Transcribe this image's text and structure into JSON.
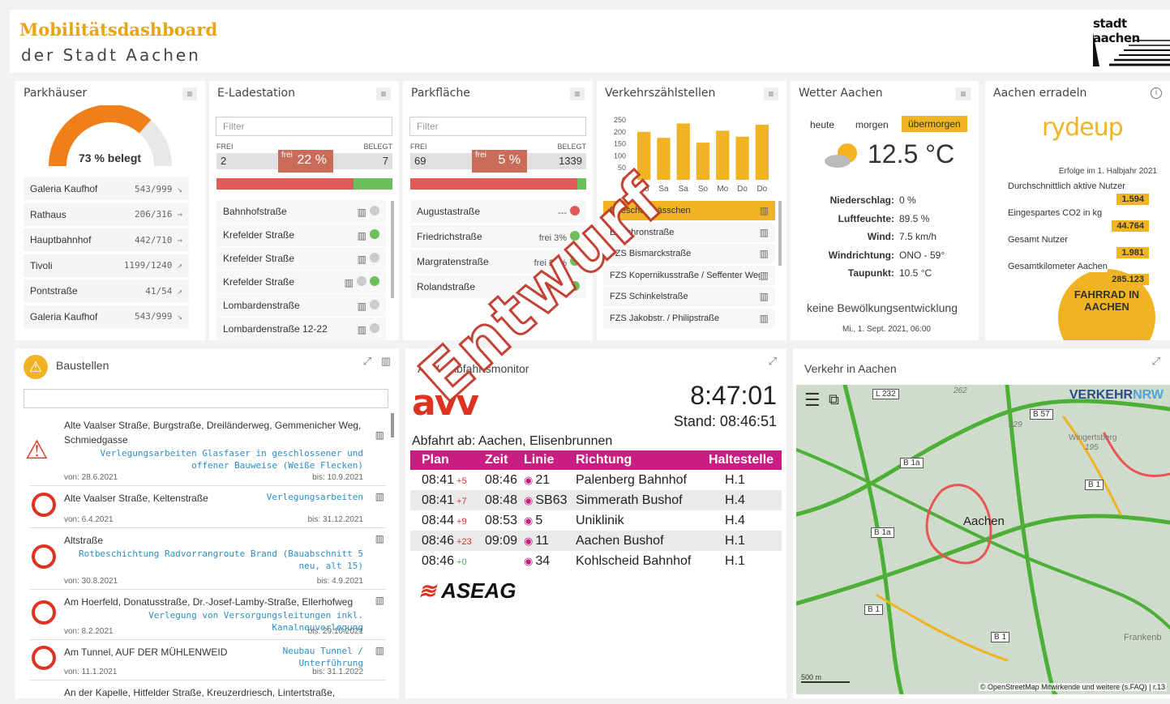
{
  "header": {
    "title": "Mobilitätsdashboard",
    "subtitle": "der Stadt Aachen",
    "logo_text": "stadt aachen"
  },
  "parkhaeuser": {
    "title": "Parkhäuser",
    "gauge_label": "73 % belegt",
    "occupancy_percent": 73,
    "items": [
      {
        "name": "Galeria Kaufhof",
        "value": "543/999",
        "trend": "↘"
      },
      {
        "name": "Rathaus",
        "value": "206/316",
        "trend": "→"
      },
      {
        "name": "Hauptbahnhof",
        "value": "442/710",
        "trend": "→"
      },
      {
        "name": "Tivoli",
        "value": "1199/1240",
        "trend": "↗"
      },
      {
        "name": "Pontstraße",
        "value": "41/54",
        "trend": "↗"
      },
      {
        "name": "Galeria Kaufhof",
        "value": "543/999",
        "trend": "↘"
      }
    ]
  },
  "eladestation": {
    "title": "E-Ladestation",
    "filter_placeholder": "Filter",
    "frei_label": "FREI",
    "belegt_label": "BELEGT",
    "frei": "2",
    "frei_small": "frei",
    "percent": "22 %",
    "belegt": "7",
    "free_fraction": 0.78,
    "items": [
      {
        "name": "Bahnhofstraße",
        "dots": [
          "#ccc"
        ]
      },
      {
        "name": "Krefelder Straße",
        "dots": [
          "#6cbf5a"
        ]
      },
      {
        "name": "Krefelder Straße",
        "dots": [
          "#ccc"
        ]
      },
      {
        "name": "Krefelder Straße",
        "dots": [
          "#ccc",
          "#6cbf5a"
        ]
      },
      {
        "name": "Lombardenstraße",
        "dots": [
          "#ccc"
        ]
      },
      {
        "name": "Lombardenstraße 12-22",
        "dots": [
          "#ccc"
        ]
      }
    ]
  },
  "parkflaeche": {
    "title": "Parkfläche",
    "filter_placeholder": "Filter",
    "frei_label": "FREI",
    "belegt_label": "BELEGT",
    "frei": "69",
    "frei_small": "frei",
    "percent": "5 %",
    "belegt": "1339",
    "free_fraction": 0.95,
    "items": [
      {
        "name": "Augustastraße",
        "value": "---",
        "color": "#e05a5a"
      },
      {
        "name": "Friedrichstraße",
        "value": "frei 3%",
        "color": "#6cbf5a"
      },
      {
        "name": "Margratenstraße",
        "value": "frei 22%",
        "color": "#6cbf5a"
      },
      {
        "name": "Rolandstraße",
        "value": "frei 7%",
        "color": "#6cbf5a"
      }
    ]
  },
  "verkehr_zaehl": {
    "title": "Verkehrszählstellen",
    "chart_data": {
      "type": "bar",
      "categories": [
        "Do",
        "Sa",
        "Sa",
        "So",
        "Mo",
        "Do",
        "Do"
      ],
      "values": [
        200,
        175,
        235,
        155,
        205,
        180,
        230
      ],
      "ylim": [
        0,
        250
      ],
      "yticks": [
        "250",
        "200",
        "150",
        "100",
        "50",
        "0"
      ]
    },
    "items": [
      {
        "name": "Driescher Gässchen"
      },
      {
        "name": "Eilfschronstraße"
      },
      {
        "name": "FZS Bismarckstraße"
      },
      {
        "name": "FZS Kopernikusstraße / Seffenter Weg"
      },
      {
        "name": "FZS Schinkelstraße"
      },
      {
        "name": "FZS Jakobstr. / Philipstraße"
      }
    ]
  },
  "wetter": {
    "title": "Wetter Aachen",
    "tabs": [
      "heute",
      "morgen",
      "übermorgen"
    ],
    "temp": "12.5",
    "unit": "°C",
    "rows": [
      {
        "k": "Niederschlag:",
        "v": "0 %"
      },
      {
        "k": "Luftfeuchte:",
        "v": "89.5 %"
      },
      {
        "k": "Wind:",
        "v": "7.5 km/h"
      },
      {
        "k": "Windrichtung:",
        "v": "ONO - 59°"
      },
      {
        "k": "Taupunkt:",
        "v": "10.5 °C"
      }
    ],
    "desc": "keine Bewölkungsentwicklung",
    "date": "Mi., 1. Sept. 2021, 06:00"
  },
  "erradeln": {
    "title": "Aachen erradeln",
    "logo": "rydeup",
    "subtitle": "Erfolge im 1. Halbjahr 2021",
    "stats": [
      {
        "k": "Durchschnittlich aktive Nutzer",
        "v": "1.594"
      },
      {
        "k": "Eingespartes CO2 in kg",
        "v": "44.764"
      },
      {
        "k": "Gesamt Nutzer",
        "v": "1.981"
      },
      {
        "k": "Gesamtkilometer Aachen",
        "v": "285.123"
      }
    ],
    "badge": "FAHRRAD IN AACHEN"
  },
  "baustellen": {
    "title": "Baustellen",
    "items": [
      {
        "title": "Alte Vaalser Straße, Burgstraße, Dreiländerweg, Gemmenicher Weg, Schmiedgasse",
        "link": "Verlegungsarbeiten Glasfaser in geschlossener und offener Bauweise (Weiße Flecken)",
        "von": "von: 28.6.2021",
        "bis": "bis: 10.9.2021"
      },
      {
        "title": "Alte Vaalser Straße, Keltenstraße",
        "link": "Verlegungsarbeiten",
        "von": "von: 6.4.2021",
        "bis": "bis: 31.12.2021"
      },
      {
        "title": "Altstraße",
        "link": "Rotbeschichtung Radvorrangroute Brand (Bauabschnitt 5 neu, alt 15)",
        "von": "von: 30.8.2021",
        "bis": "bis: 4.9.2021"
      },
      {
        "title": "Am Hoerfeld, Donatusstraße, Dr.-Josef-Lamby-Straße, Ellerhofweg",
        "link": "Verlegung von Versorgungsleitungen inkl. Kanalneuverlegung",
        "von": "von: 8.2.2021",
        "bis": "bis: 29.10.2021"
      },
      {
        "title": "Am Tunnel, AUF DER MÜHLENWEID",
        "link": "Neubau Tunnel / Unterführung",
        "von": "von: 11.1.2021",
        "bis": "bis: 31.1.2022"
      },
      {
        "title": "An der Kapelle, Hitfelder Straße, Kreuzerdriesch, Lintertstraße,",
        "link": "",
        "von": "",
        "bis": ""
      }
    ]
  },
  "avv": {
    "title": "AVV - Abfahrtsmonitor",
    "logo": "avv",
    "time": "8:47:01",
    "stand": "Stand: 08:46:51",
    "stop": "Abfahrt ab: Aachen, Elisenbrunnen",
    "headers": [
      "Plan",
      "Zeit",
      "Linie",
      "Richtung",
      "Haltestelle"
    ],
    "rows": [
      {
        "plan": "08:41",
        "delay": "+5",
        "zeit": "08:46",
        "linie": "21",
        "richtung": "Palenberg Bahnhof",
        "halt": "H.1"
      },
      {
        "plan": "08:41",
        "delay": "+7",
        "zeit": "08:48",
        "linie": "SB63",
        "richtung": "Simmerath Bushof",
        "halt": "H.4"
      },
      {
        "plan": "08:44",
        "delay": "+9",
        "zeit": "08:53",
        "linie": "5",
        "richtung": "Uniklinik",
        "halt": "H.4"
      },
      {
        "plan": "08:46",
        "delay": "+23",
        "zeit": "09:09",
        "linie": "11",
        "richtung": "Aachen Bushof",
        "halt": "H.1"
      },
      {
        "plan": "08:46",
        "delay": "+0",
        "zeit": "",
        "linie": "34",
        "richtung": "Kohlscheid Bahnhof",
        "halt": "H.1"
      }
    ],
    "aseag": "ASEAG"
  },
  "verkehr_aachen": {
    "title": "Verkehr in Aachen",
    "brand1": "VERKEHR",
    "brand2": "NRW",
    "city": "Aachen",
    "roads": [
      "L 232",
      "B 57",
      "B 1a",
      "B 1a",
      "B 1",
      "B 1",
      "B 1"
    ],
    "places": [
      "262",
      "229",
      "Wingertsberg",
      "195",
      "Frankenb"
    ],
    "scale": "500 m",
    "attribution": "© OpenStreetMap Mitwirkende und weitere (s.FAQ) | r.13"
  },
  "watermark": "Entwurf"
}
